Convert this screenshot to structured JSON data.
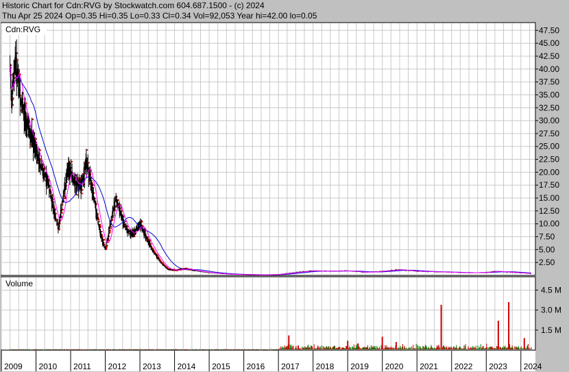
{
  "header": {
    "line1": "Historic Chart for Cdn:RVG by Stockwatch.com 604.687.1500 - (c) 2024",
    "line2": "Thu Apr 25 2024  Op=0.35  Hi=0.35  Lo=0.33  Cl=0.34  Vol=92,053  Year hi=42.00  lo=0.05"
  },
  "colors": {
    "background": "#c0c0c0",
    "panel": "#ffffff",
    "grid": "#c8c8c8",
    "bar": "#000000",
    "ma_short": "#ff00ff",
    "ma_long": "#0000cc",
    "volume_up": "#008000",
    "volume_down": "#cc0000",
    "close_tick": "#cc0000"
  },
  "chart_data": [
    {
      "type": "line",
      "name": "price",
      "label": "Cdn:RVG",
      "x_years": [
        "2009",
        "2010",
        "2011",
        "2012",
        "2013",
        "2014",
        "2015",
        "2016",
        "2017",
        "2018",
        "2019",
        "2020",
        "2021",
        "2022",
        "2023",
        "2024"
      ],
      "yticks": [
        "47.50",
        "45.00",
        "42.50",
        "40.00",
        "37.50",
        "35.00",
        "32.50",
        "30.00",
        "27.50",
        "25.00",
        "22.50",
        "20.00",
        "17.50",
        "15.00",
        "12.50",
        "10.00",
        "7.50",
        "5.00",
        "2.50"
      ],
      "ylim": [
        0,
        49
      ],
      "grid": true,
      "points": [
        {
          "x": 2009.25,
          "y": 40
        },
        {
          "x": 2009.3,
          "y": 34
        },
        {
          "x": 2009.4,
          "y": 42
        },
        {
          "x": 2009.55,
          "y": 34
        },
        {
          "x": 2009.8,
          "y": 28
        },
        {
          "x": 2010.0,
          "y": 24
        },
        {
          "x": 2010.2,
          "y": 20
        },
        {
          "x": 2010.35,
          "y": 18
        },
        {
          "x": 2010.5,
          "y": 13
        },
        {
          "x": 2010.65,
          "y": 9
        },
        {
          "x": 2010.8,
          "y": 16
        },
        {
          "x": 2010.95,
          "y": 21
        },
        {
          "x": 2011.1,
          "y": 18
        },
        {
          "x": 2011.3,
          "y": 17
        },
        {
          "x": 2011.45,
          "y": 22
        },
        {
          "x": 2011.6,
          "y": 18
        },
        {
          "x": 2011.75,
          "y": 12
        },
        {
          "x": 2011.9,
          "y": 7
        },
        {
          "x": 2012.0,
          "y": 5
        },
        {
          "x": 2012.15,
          "y": 10
        },
        {
          "x": 2012.3,
          "y": 15
        },
        {
          "x": 2012.45,
          "y": 12
        },
        {
          "x": 2012.6,
          "y": 9
        },
        {
          "x": 2012.8,
          "y": 8
        },
        {
          "x": 2013.0,
          "y": 10
        },
        {
          "x": 2013.2,
          "y": 7
        },
        {
          "x": 2013.4,
          "y": 4.5
        },
        {
          "x": 2013.6,
          "y": 2.5
        },
        {
          "x": 2013.8,
          "y": 1.2
        },
        {
          "x": 2014.0,
          "y": 1.0
        },
        {
          "x": 2014.3,
          "y": 1.3
        },
        {
          "x": 2014.6,
          "y": 0.9
        },
        {
          "x": 2015.0,
          "y": 0.5
        },
        {
          "x": 2015.5,
          "y": 0.25
        },
        {
          "x": 2016.0,
          "y": 0.15
        },
        {
          "x": 2016.5,
          "y": 0.1
        },
        {
          "x": 2017.0,
          "y": 0.2
        },
        {
          "x": 2017.5,
          "y": 0.6
        },
        {
          "x": 2018.0,
          "y": 0.9
        },
        {
          "x": 2018.5,
          "y": 0.8
        },
        {
          "x": 2019.0,
          "y": 0.9
        },
        {
          "x": 2019.5,
          "y": 0.6
        },
        {
          "x": 2020.0,
          "y": 0.8
        },
        {
          "x": 2020.5,
          "y": 1.1
        },
        {
          "x": 2021.0,
          "y": 0.8
        },
        {
          "x": 2021.5,
          "y": 0.7
        },
        {
          "x": 2022.0,
          "y": 0.6
        },
        {
          "x": 2022.5,
          "y": 0.5
        },
        {
          "x": 2023.0,
          "y": 0.6
        },
        {
          "x": 2023.3,
          "y": 0.8
        },
        {
          "x": 2023.7,
          "y": 0.6
        },
        {
          "x": 2024.3,
          "y": 0.34
        }
      ]
    },
    {
      "type": "bar",
      "name": "volume",
      "label": "Volume",
      "yticks": [
        "4.5 M",
        "3.0 M",
        "1.5 M"
      ],
      "ylim": [
        0,
        5.5
      ],
      "spikes": [
        {
          "x": 2017.3,
          "v": 1.1
        },
        {
          "x": 2019.0,
          "v": 0.7
        },
        {
          "x": 2019.3,
          "v": 0.5
        },
        {
          "x": 2020.0,
          "v": 1.0
        },
        {
          "x": 2020.4,
          "v": 0.6
        },
        {
          "x": 2021.7,
          "v": 3.4
        },
        {
          "x": 2023.35,
          "v": 2.2
        },
        {
          "x": 2023.65,
          "v": 3.6
        },
        {
          "x": 2024.1,
          "v": 0.9
        }
      ]
    }
  ]
}
